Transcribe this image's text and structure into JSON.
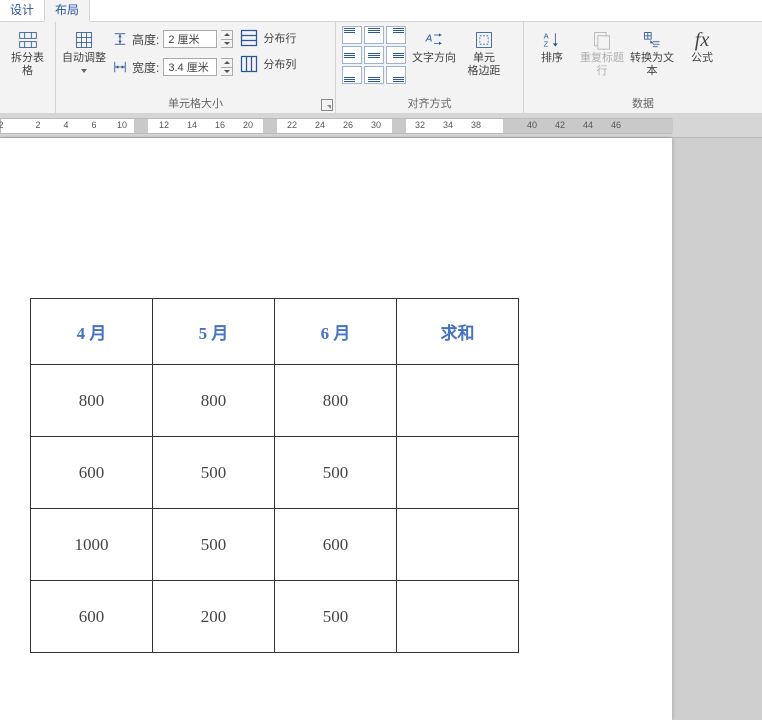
{
  "tabs": {
    "design": "设计",
    "layout": "布局"
  },
  "ribbon": {
    "merge_group": {
      "split_table": "拆分表格"
    },
    "cellsize_group": {
      "label": "单元格大小",
      "autofit": "自动调整",
      "height_label": "高度:",
      "height_value": "2 厘米",
      "width_label": "宽度:",
      "width_value": "3.4 厘米",
      "dist_rows": "分布行",
      "dist_cols": "分布列"
    },
    "align_group": {
      "label": "对齐方式",
      "text_dir": "文字方向",
      "cell_margins": "单元\n格边距"
    },
    "data_group": {
      "label": "数据",
      "sort": "排序",
      "repeat_header": "重复标题行",
      "to_text": "转换为文本",
      "formula": "公式"
    }
  },
  "ruler_numbers": [
    2,
    2,
    4,
    6,
    10,
    12,
    14,
    16,
    20,
    22,
    24,
    26,
    30,
    32,
    34,
    38,
    40,
    42,
    44,
    46
  ],
  "table": {
    "headers": [
      "4 月",
      "5 月",
      "6 月",
      "求和"
    ],
    "rows": [
      [
        "800",
        "800",
        "800",
        ""
      ],
      [
        "600",
        "500",
        "500",
        ""
      ],
      [
        "1000",
        "500",
        "600",
        ""
      ],
      [
        "600",
        "200",
        "500",
        ""
      ]
    ]
  }
}
